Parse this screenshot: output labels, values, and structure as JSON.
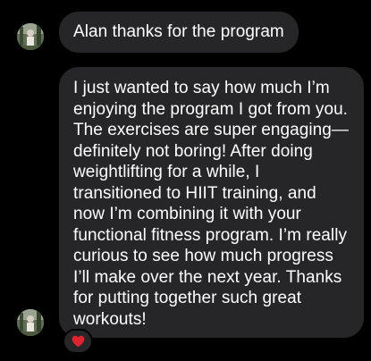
{
  "conversation": {
    "messages": [
      {
        "sender_avatar": "avatar-icon",
        "text": "Alan thanks for the program"
      },
      {
        "sender_avatar": "avatar-icon",
        "text": "I just wanted to say how much I’m enjoying the program I got from you. The exercises are super engaging—definitely not boring! After doing weightlifting for a while, I transitioned to HIIT training, and now I’m combining it with your functional fitness program. I’m really curious to see how much progress I’ll make over the next year. Thanks for putting together such great workouts!",
        "reaction": {
          "icon": "red-heart-icon",
          "color": "#e0242f"
        }
      }
    ]
  },
  "colors": {
    "background": "#000000",
    "bubble": "#262628",
    "text": "#ffffff"
  }
}
